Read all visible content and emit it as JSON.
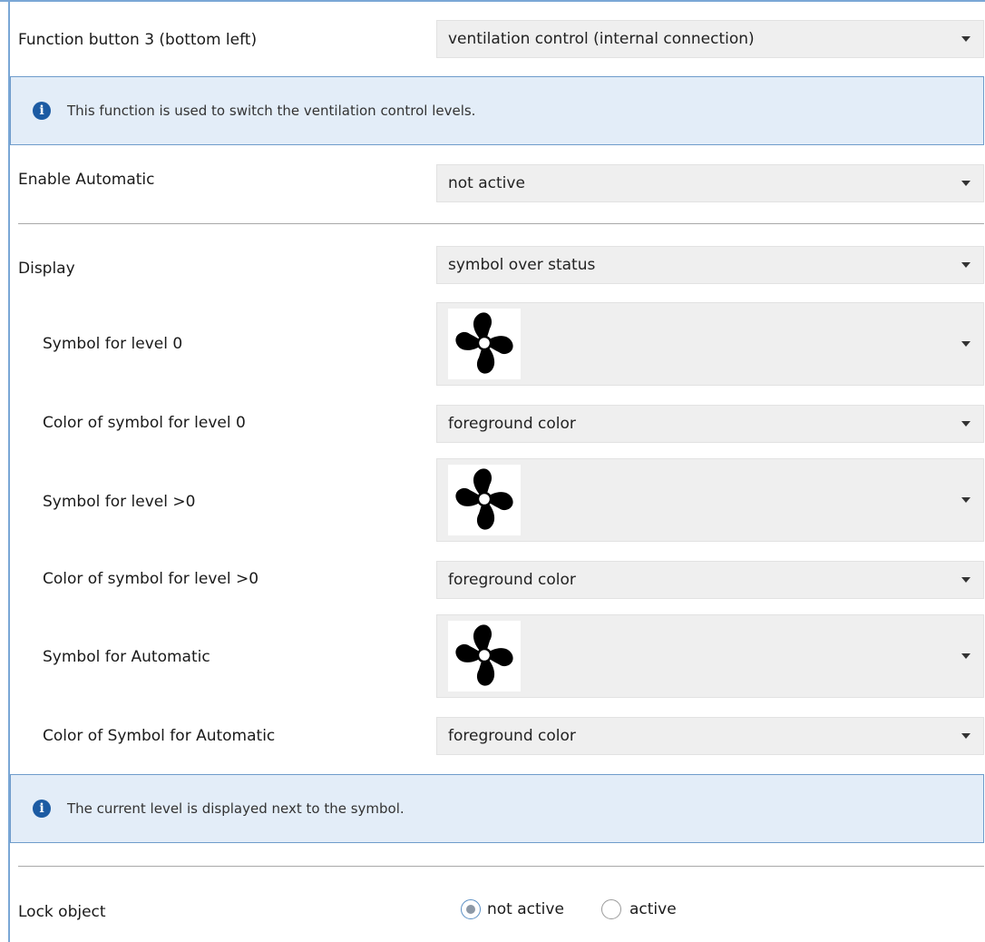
{
  "function_button": {
    "label": "Function button 3 (bottom left)",
    "value": "ventilation control (internal connection)"
  },
  "info_top": {
    "text": "This function is used to switch the ventilation control levels."
  },
  "enable_automatic": {
    "label": "Enable Automatic",
    "value": "not active"
  },
  "display": {
    "label": "Display",
    "value": "symbol over status"
  },
  "symbol_level0": {
    "label": "Symbol for level 0",
    "icon": "fan-icon"
  },
  "color_level0": {
    "label": "Color of symbol for level 0",
    "value": "foreground color"
  },
  "symbol_level_gt0": {
    "label": "Symbol for level >0",
    "icon": "fan-icon"
  },
  "color_level_gt0": {
    "label": "Color of symbol for level >0",
    "value": "foreground color"
  },
  "symbol_automatic": {
    "label": "Symbol for Automatic",
    "icon": "fan-icon"
  },
  "color_automatic": {
    "label": "Color of Symbol for Automatic",
    "value": "foreground color"
  },
  "info_bottom": {
    "text": "The current level is displayed next to the symbol."
  },
  "lock_object": {
    "label": "Lock object",
    "options": [
      "not active",
      "active"
    ],
    "selected": "not active"
  },
  "colors": {
    "info_bg": "#e3edf8",
    "info_border": "#6f9ccb",
    "info_icon": "#1c5ba3",
    "select_bg": "#efefef",
    "frame": "#7aa7d6"
  }
}
